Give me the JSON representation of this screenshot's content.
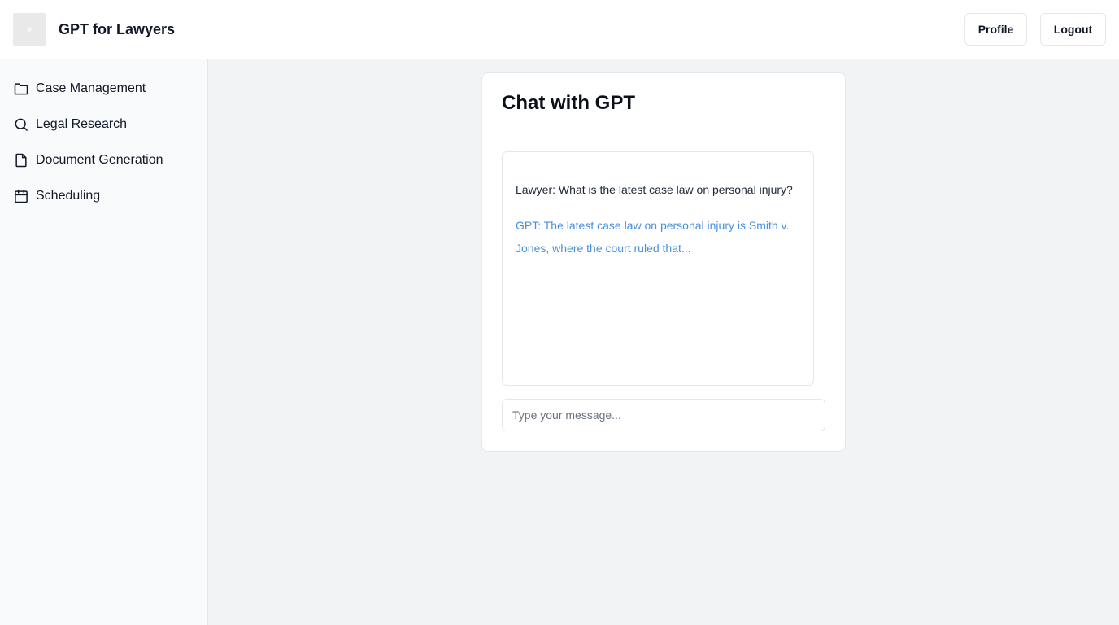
{
  "header": {
    "app_title": "GPT for Lawyers",
    "logo_icon": "logo-placeholder-icon",
    "profile_label": "Profile",
    "logout_label": "Logout"
  },
  "sidebar": {
    "items": [
      {
        "label": "Case Management",
        "icon": "folder-icon"
      },
      {
        "label": "Legal Research",
        "icon": "search-icon"
      },
      {
        "label": "Document Generation",
        "icon": "document-icon"
      },
      {
        "label": "Scheduling",
        "icon": "calendar-icon"
      }
    ]
  },
  "chat": {
    "title": "Chat with GPT",
    "messages": [
      {
        "sender": "Lawyer",
        "text": "Lawyer: What is the latest case law on personal injury?"
      },
      {
        "sender": "GPT",
        "text": "GPT: The latest case law on personal injury is Smith v. Jones, where the court ruled that..."
      }
    ],
    "input_placeholder": "Type your message...",
    "input_value": ""
  },
  "colors": {
    "gpt_message": "#4a90d9",
    "main_background": "#f2f3f5",
    "border": "#e5e7eb"
  }
}
